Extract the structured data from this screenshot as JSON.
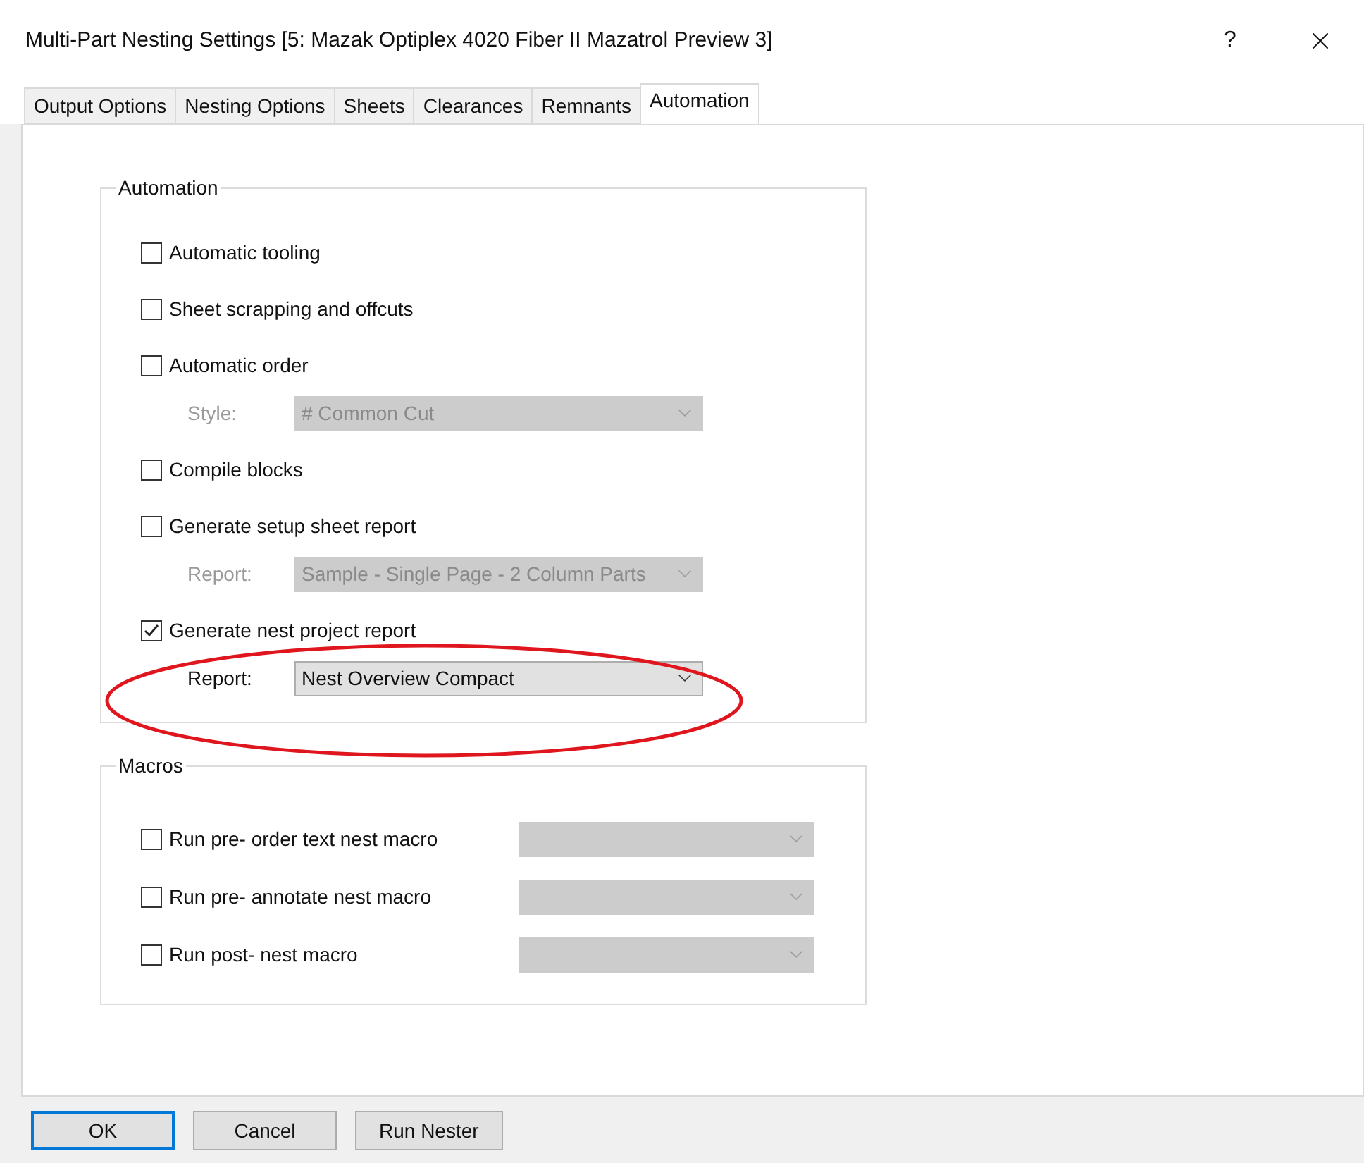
{
  "window": {
    "title": "Multi-Part Nesting Settings [5: Mazak Optiplex 4020 Fiber II Mazatrol Preview 3]",
    "help": "?"
  },
  "tabs": [
    {
      "label": "Output Options",
      "selected": false
    },
    {
      "label": "Nesting Options",
      "selected": false
    },
    {
      "label": "Sheets",
      "selected": false
    },
    {
      "label": "Clearances",
      "selected": false
    },
    {
      "label": "Remnants",
      "selected": false
    },
    {
      "label": "Automation",
      "selected": true
    }
  ],
  "automation": {
    "title": "Automation",
    "items": [
      {
        "kind": "checkbox",
        "label": "Automatic tooling",
        "checked": false
      },
      {
        "kind": "checkbox",
        "label": "Sheet scrapping and offcuts",
        "checked": false
      },
      {
        "kind": "checkbox",
        "label": "Automatic order",
        "checked": false
      },
      {
        "kind": "combo",
        "label": "Style:",
        "value": "# Common Cut",
        "disabled": true
      },
      {
        "kind": "checkbox",
        "label": "Compile blocks",
        "checked": false
      },
      {
        "kind": "checkbox",
        "label": "Generate setup sheet report",
        "checked": false
      },
      {
        "kind": "combo",
        "label": "Report:",
        "value": "Sample - Single Page - 2 Column Parts",
        "disabled": true
      },
      {
        "kind": "checkbox",
        "label": "Generate nest project report",
        "checked": true
      },
      {
        "kind": "combo",
        "label": "Report:",
        "value": "Nest Overview Compact",
        "disabled": false
      }
    ]
  },
  "macros": {
    "title": "Macros",
    "items": [
      {
        "label": "Run pre- order text nest macro",
        "checked": false,
        "disabled": true
      },
      {
        "label": "Run pre- annotate nest macro",
        "checked": false,
        "disabled": true
      },
      {
        "label": "Run post- nest macro",
        "checked": false,
        "disabled": true
      }
    ]
  },
  "buttons": [
    {
      "label": "OK",
      "default": true
    },
    {
      "label": "Cancel",
      "default": false
    },
    {
      "label": "Run Nester",
      "default": false
    }
  ]
}
